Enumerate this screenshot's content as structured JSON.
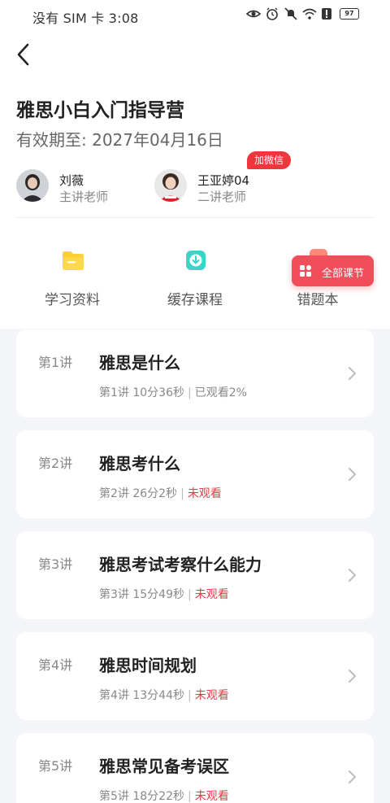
{
  "status_bar": {
    "carrier_time": "没有 SIM 卡 3:08",
    "battery": "97",
    "icons": [
      "eye-icon",
      "alarm-icon",
      "mute-icon",
      "wifi-icon",
      "alert-icon",
      "battery-icon"
    ]
  },
  "header": {
    "title": "雅思小白入门指导营",
    "valid_until": "有效期至: 2027年04月16日"
  },
  "teachers": [
    {
      "name": "刘薇",
      "role": "主讲老师"
    },
    {
      "name": "王亚婷04",
      "role": "二讲老师",
      "badge": "加微信"
    }
  ],
  "actions": [
    {
      "label": "学习资料",
      "icon": "folder-icon",
      "color": "#ffcc33"
    },
    {
      "label": "缓存课程",
      "icon": "download-icon",
      "color": "#3fd3c8"
    },
    {
      "label": "错题本",
      "icon": "wrong-book-icon",
      "color": "#ff8a7a"
    }
  ],
  "all_lessons_button": "全部课节",
  "lessons": [
    {
      "num": "第1讲",
      "title": "雅思是什么",
      "meta": "第1讲 10分36秒",
      "status": "已观看2%"
    },
    {
      "num": "第2讲",
      "title": "雅思考什么",
      "meta": "第2讲 26分2秒",
      "status": "未观看"
    },
    {
      "num": "第3讲",
      "title": "雅思考试考察什么能力",
      "meta": "第3讲 15分49秒",
      "status": "未观看"
    },
    {
      "num": "第4讲",
      "title": "雅思时间规划",
      "meta": "第4讲 13分44秒",
      "status": "未观看"
    },
    {
      "num": "第5讲",
      "title": "雅思常见备考误区",
      "meta": "第5讲 18分22秒",
      "status": "未观看"
    }
  ],
  "colors": {
    "accent_red": "#e53945",
    "badge_red": "#f0363d",
    "button_red": "#f04e5a"
  }
}
